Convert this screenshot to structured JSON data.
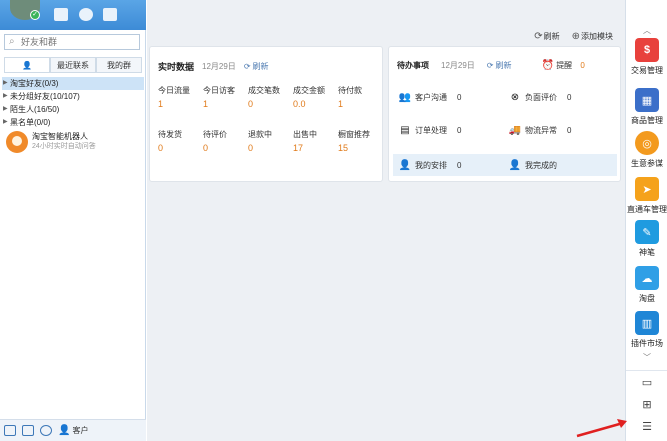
{
  "contacts": {
    "search_placeholder": "好友和群",
    "tabs": [
      "",
      "最近联系",
      "我的群"
    ],
    "groups": [
      {
        "label": "淘宝好友(0/3)",
        "selected": true
      },
      {
        "label": "未分组好友(10/107)",
        "selected": false
      },
      {
        "label": "陌生人(16/50)",
        "selected": false
      },
      {
        "label": "黑名单(0/0)",
        "selected": false
      }
    ],
    "bot_name": "淘宝智能机器人",
    "bot_desc": "24小时实时自动问答",
    "customer_label": "客户"
  },
  "toolbar": {
    "refresh_label": "刷新",
    "add_module_label": "添加模块"
  },
  "realtime": {
    "title": "实时数据",
    "date": "12月29日",
    "refresh": "刷新",
    "row1": [
      {
        "label": "今日流量",
        "value": "1"
      },
      {
        "label": "今日访客",
        "value": "1"
      },
      {
        "label": "成交笔数",
        "value": "0"
      },
      {
        "label": "成交金额",
        "value": "0.0"
      },
      {
        "label": "待付款",
        "value": "1"
      }
    ],
    "row2": [
      {
        "label": "待发货",
        "value": "0"
      },
      {
        "label": "待评价",
        "value": "0"
      },
      {
        "label": "退款中",
        "value": "0"
      },
      {
        "label": "出售中",
        "value": "17"
      },
      {
        "label": "橱窗推荐",
        "value": "15"
      }
    ]
  },
  "todo": {
    "title": "待办事项",
    "date": "12月29日",
    "refresh": "刷新",
    "reminder_label": "提醒",
    "reminder_count": "0",
    "items": [
      {
        "label": "客户沟通",
        "count": "0"
      },
      {
        "label": "负面评价",
        "count": "0"
      },
      {
        "label": "订单处理",
        "count": "0"
      },
      {
        "label": "物流异常",
        "count": "0"
      },
      {
        "label": "我的安排",
        "count": "0"
      },
      {
        "label": "我完成的",
        "count": ""
      }
    ]
  },
  "dock": {
    "items": [
      {
        "label": "交易管理",
        "color": "#e8413c",
        "icon": "trade-icon"
      },
      {
        "label": "商品管理",
        "color": "#3b6fc9",
        "icon": "goods-icon"
      },
      {
        "label": "生意参谋",
        "color": "#f39a1e",
        "icon": "compass-icon"
      },
      {
        "label": "直通车管理",
        "color": "#f5a21b",
        "icon": "car-icon"
      },
      {
        "label": "神笔",
        "color": "#1f9be0",
        "icon": "pen-icon"
      },
      {
        "label": "淘盘",
        "color": "#2f9fe6",
        "icon": "cloud-icon"
      },
      {
        "label": "插件市场",
        "color": "#1f86d6",
        "icon": "store-icon"
      }
    ]
  }
}
